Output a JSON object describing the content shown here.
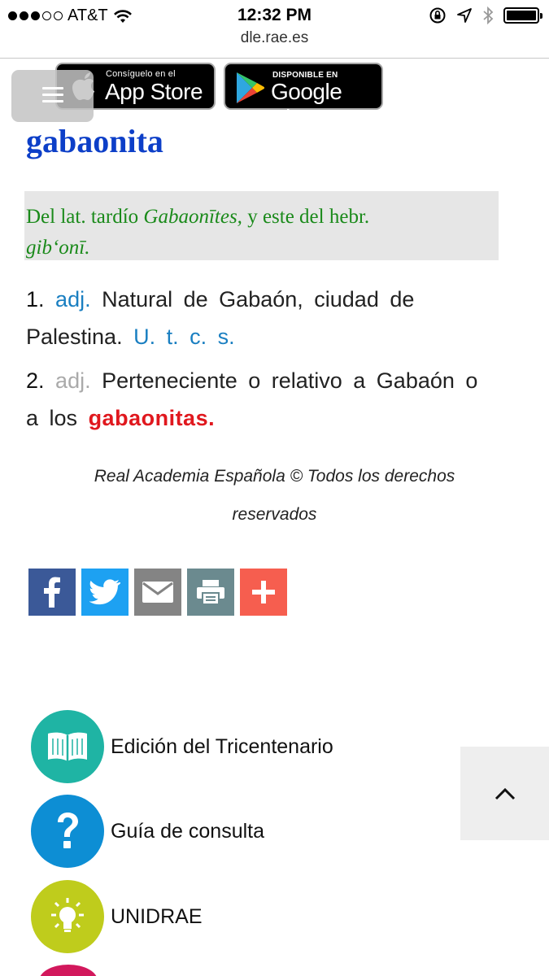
{
  "status_bar": {
    "carrier": "AT&T",
    "time": "12:32 PM",
    "signal_bars_filled": 3,
    "signal_bars_total": 5
  },
  "browser": {
    "url": "dle.rae.es"
  },
  "badges": {
    "app_store_small": "Consíguelo en el",
    "app_store_big": "App Store",
    "google_play_small": "DISPONIBLE EN",
    "google_play_big": "Google Play"
  },
  "entry": {
    "headword": "gabaonita",
    "etymology": {
      "part1": "Del lat.  tardío ",
      "latin_form": "Gabaonītes,",
      "part2": " y este del hebr.",
      "hebrew_form": "gib‘onī."
    },
    "senses": [
      {
        "number": "1.",
        "abbr": "adj.",
        "definition": "Natural de Gabaón, ciudad de Palestina.",
        "usage": "U. t. c. s."
      },
      {
        "number": "2.",
        "abbr": "adj.",
        "definition": "Perteneciente o relativo a Gabaón o a los",
        "crossref": "gabaonitas."
      }
    ]
  },
  "copyright": {
    "line1": "Real Academia Española © Todos los derechos",
    "line2": "reservados"
  },
  "share_icons": [
    "facebook-icon",
    "twitter-icon",
    "email-icon",
    "print-icon",
    "plus-icon"
  ],
  "links": [
    {
      "label": "Edición del Tricentenario",
      "icon": "book-icon",
      "color": "#1fb4a4"
    },
    {
      "label": "Guía de consulta",
      "icon": "question-icon",
      "color": "#0d8ed4"
    },
    {
      "label": "UNIDRAE",
      "icon": "lightbulb-icon",
      "color": "#bfcc1c"
    }
  ],
  "colors": {
    "headword": "#0d3fc8",
    "etymology_text": "#1a8a1a",
    "etymology_bg": "#e6e6e6",
    "abbreviation": "#1a7fc1",
    "crossref": "#e0181e"
  }
}
